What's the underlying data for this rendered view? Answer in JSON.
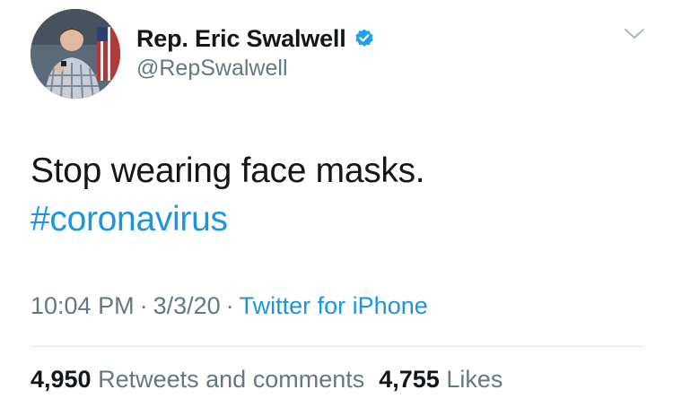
{
  "author": {
    "display_name": "Rep. Eric Swalwell",
    "handle": "@RepSwalwell",
    "verified_icon": "verified-badge-icon",
    "avatar_icon": "profile-photo"
  },
  "tweet": {
    "text_line1": "Stop wearing face masks.",
    "hashtag": "#coronavirus"
  },
  "meta": {
    "time": "10:04 PM",
    "separator": "·",
    "date": "3/3/20",
    "source": "Twitter for iPhone"
  },
  "stats": {
    "retweets_count": "4,950",
    "retweets_label": "Retweets and comments",
    "likes_count": "4,755",
    "likes_label": "Likes"
  },
  "colors": {
    "link_blue": "#1b95e0",
    "secondary_gray": "#657786",
    "primary_text": "#14171a",
    "divider": "#e1e8ed"
  }
}
